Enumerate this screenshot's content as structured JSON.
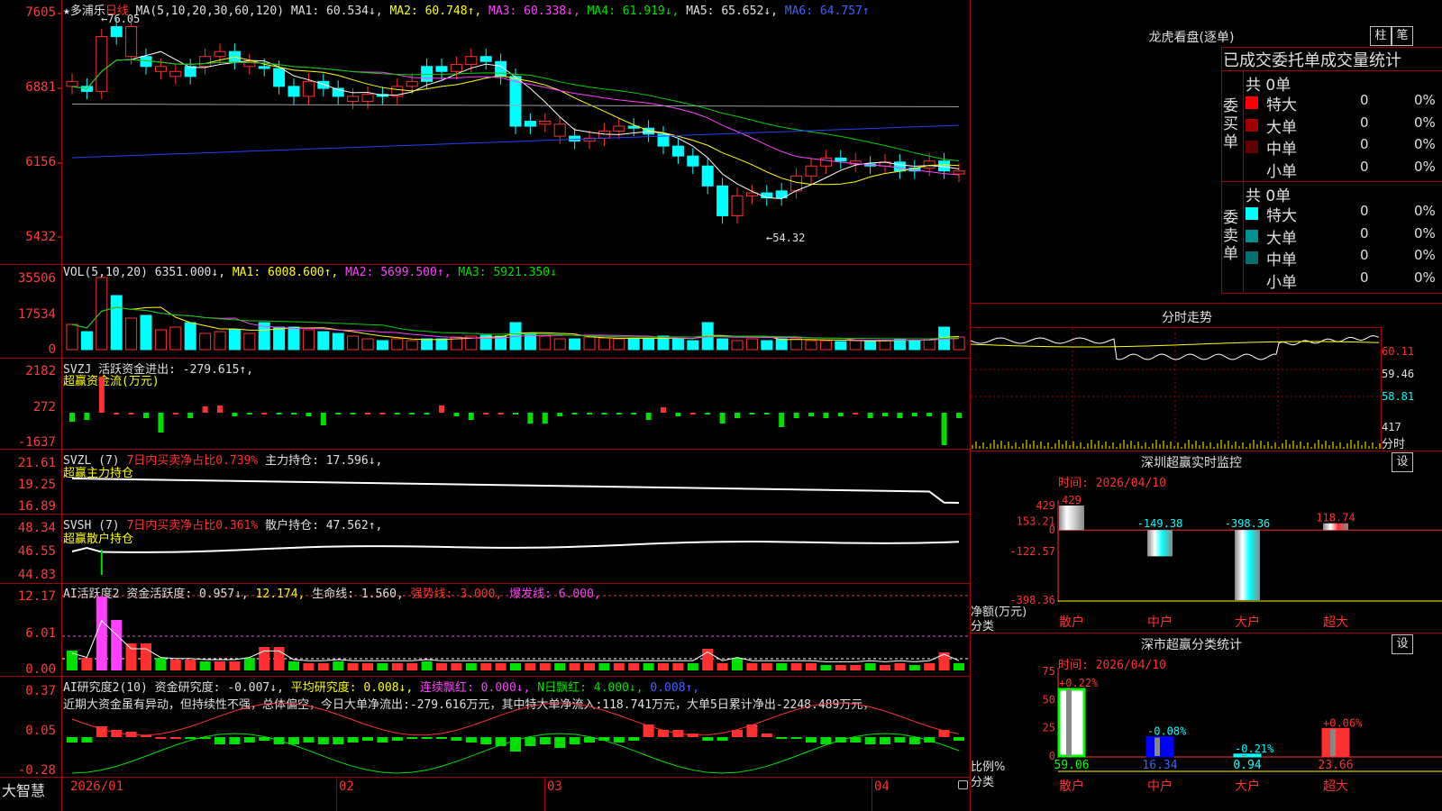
{
  "kline": {
    "title": "★多浦乐",
    "period": "日线",
    "ma_label": "MA(5,10,20,30,60,120)",
    "ma1": "MA1: 60.534↓,",
    "ma2": "MA2: 60.748↑,",
    "ma3": "MA3: 60.338↓,",
    "ma4": "MA4: 61.919↓,",
    "ma5": "MA5: 65.652↓,",
    "ma6": "MA6: 64.757↑",
    "y_ticks": [
      "7605",
      "6881",
      "6156",
      "5432"
    ],
    "high_note": "←76.05",
    "low_note": "←54.32"
  },
  "vol": {
    "label": "VOL(5,10,20)",
    "value": "6351.000↓,",
    "ma1": "MA1: 6008.600↑,",
    "ma2": "MA2: 5699.500↑,",
    "ma3": "MA3: 5921.350↓",
    "y_ticks": [
      "35506",
      "17534",
      "0"
    ]
  },
  "svzj": {
    "label": "SVZJ",
    "desc": "活跃资金进出: -279.615↑,",
    "sub": "超赢资金流(万元)",
    "y_ticks": [
      "2182",
      "272",
      "-1637"
    ]
  },
  "svzl": {
    "label": "SVZL (7)",
    "desc1": "7日内买卖净占比0.739%",
    "desc2": "主力持仓: 17.596↓,",
    "sub": "超赢主力持仓",
    "y_ticks": [
      "21.61",
      "19.25",
      "16.89"
    ]
  },
  "svsh": {
    "label": "SVSH (7)",
    "desc1": "7日内买卖净占比0.361%",
    "desc2": "散户持仓: 47.562↑,",
    "sub": "超赢散户持仓",
    "y_ticks": [
      "48.34",
      "46.55",
      "44.83"
    ]
  },
  "ai1": {
    "label": "AI活跃度2",
    "desc1": "资金活跃度: 0.957↓,",
    "desc2": "12.174,",
    "desc3": "生命线: 1.560,",
    "desc4": "强势线: 3.000,",
    "desc5": "爆发线: 6.000,",
    "y_ticks": [
      "12.17",
      "6.01",
      "0.00"
    ]
  },
  "ai2": {
    "label": "AI研究度2(10)",
    "desc1": "资金研究度: -0.007↓,",
    "desc2": "平均研究度: 0.008↓,",
    "desc3": "连续飘红: 0.000↓,",
    "desc4": "N日飘红: 4.000↓,",
    "desc5": "0.008↑,",
    "text": "近期大资金虽有异动，但持续性不强，总体偏空，今日大单净流出:-279.616万元，其中特大单净流入:118.741万元，大单5日累计净出-2248.489万元，",
    "y_ticks": [
      "0.37",
      "0.05",
      "-0.28"
    ]
  },
  "bottom": {
    "brand": "大智慧",
    "dates": [
      "2026/01",
      "02",
      "03",
      "04"
    ]
  },
  "dragon": {
    "title": "龙虎看盘(逐单)",
    "btn1": "柱",
    "btn2": "笔",
    "subtitle": "已成交委托单成交量统计",
    "buy_label": "委买单",
    "sell_label": "委卖单",
    "buy_total": "共 0单",
    "sell_total": "共 0单",
    "buy_rows": [
      {
        "name": "特大",
        "val": "0",
        "pct": "0%",
        "color": "#ff0000"
      },
      {
        "name": "大单",
        "val": "0",
        "pct": "0%",
        "color": "#a00000"
      },
      {
        "name": "中单",
        "val": "0",
        "pct": "0%",
        "color": "#600000"
      },
      {
        "name": "小单",
        "val": "0",
        "pct": "0%",
        "color": "#000000"
      }
    ],
    "sell_rows": [
      {
        "name": "特大",
        "val": "0",
        "pct": "0%",
        "color": "#00ffff"
      },
      {
        "name": "大单",
        "val": "0",
        "pct": "0%",
        "color": "#009090"
      },
      {
        "name": "中单",
        "val": "0",
        "pct": "0%",
        "color": "#007070"
      },
      {
        "name": "小单",
        "val": "0",
        "pct": "0%",
        "color": "#000000"
      }
    ]
  },
  "intraday": {
    "title": "分时走势",
    "y_ticks": [
      "60.11",
      "59.46",
      "58.81"
    ],
    "vol_tick": "417",
    "vol_label": "分时"
  },
  "monitor": {
    "title": "深圳超赢实时监控",
    "btn": "设",
    "time": "时间: 2026/04/10",
    "y_ticks": [
      "429",
      "153.21",
      "0",
      "-122.57",
      "-398.36"
    ],
    "ylabel": "净额(万元)",
    "xlabel": "分类",
    "categories": [
      "散户",
      "中户",
      "大户",
      "超大"
    ],
    "values": [
      429,
      -149.38,
      -398.36,
      118.74
    ],
    "labels": [
      "429",
      "-149.38",
      "-398.36",
      "118.74"
    ]
  },
  "classify": {
    "title": "深市超赢分类统计",
    "btn": "设",
    "time": "时间: 2026/04/10",
    "y_ticks": [
      "75",
      "50",
      "25",
      "0"
    ],
    "ylabel": "比例%",
    "xlabel": "分类",
    "categories": [
      "散户",
      "中户",
      "大户",
      "超大"
    ],
    "values": [
      59.06,
      16.34,
      0.94,
      23.66
    ],
    "values_text": [
      "59.06",
      "16.34",
      "0.94",
      "23.66"
    ],
    "changes": [
      "+0.22%",
      "-0.08%",
      "-0.21%",
      "+0.06%"
    ]
  }
}
